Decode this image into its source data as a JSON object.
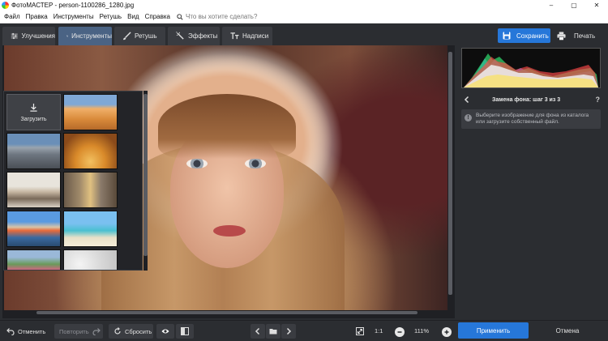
{
  "window": {
    "title": "ФотоМАСТЕР - person-1100286_1280.jpg",
    "minimize": "–",
    "maximize": "▢",
    "close": "✕"
  },
  "menu": {
    "items": [
      "Файл",
      "Правка",
      "Инструменты",
      "Ретушь",
      "Вид",
      "Справка"
    ],
    "search_placeholder": "Что вы хотите сделать?"
  },
  "toolbar": {
    "tabs": [
      {
        "label": "Улучшения",
        "icon": "sliders-icon",
        "active": false
      },
      {
        "label": "Инструменты",
        "icon": "crop-icon",
        "active": true
      },
      {
        "label": "Ретушь",
        "icon": "brush-icon",
        "active": false
      },
      {
        "label": "Эффекты",
        "icon": "magic-wand-icon",
        "active": false
      },
      {
        "label": "Надписи",
        "icon": "text-icon",
        "active": false
      }
    ],
    "save_label": "Сохранить",
    "print_label": "Печать"
  },
  "panel": {
    "title": "Замена фона: шаг 3 из 3",
    "help": "?",
    "info_text": "Выберите изображение для фона из каталога или загрузите собственный файл.",
    "info_icon": "!",
    "upload_label": "Загрузить",
    "thumbnails": [
      "desert",
      "autumn-park",
      "city-skyline",
      "autumn-road",
      "living-room",
      "city-street",
      "harbor-houses",
      "beach",
      "flower-garden",
      "white-texture"
    ]
  },
  "bottom": {
    "undo_label": "Отменить",
    "redo_label": "Повторить",
    "reset_label": "Сбросить",
    "zoom_ratio": "1:1",
    "zoom_level": "111%",
    "apply_label": "Применить",
    "cancel_label": "Отмена"
  },
  "colors": {
    "accent": "#2677d9",
    "active_tab": "#4a6384",
    "background": "#2b2d31"
  }
}
